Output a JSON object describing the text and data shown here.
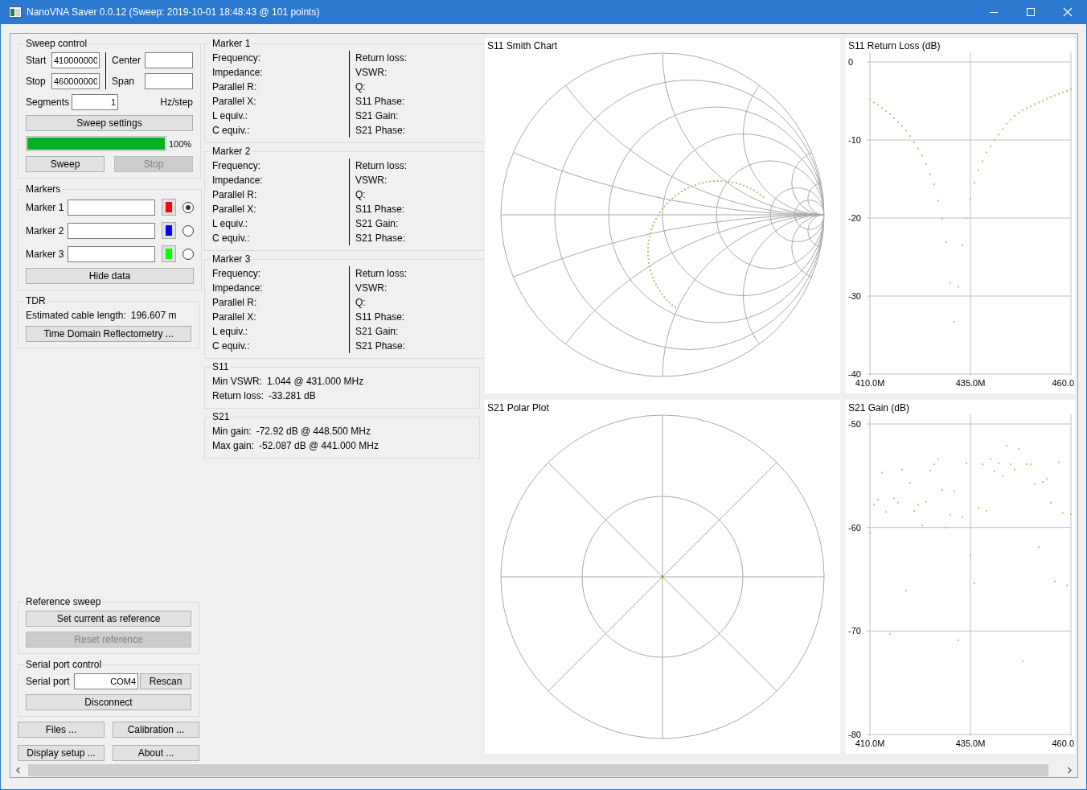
{
  "window": {
    "title": "NanoVNA Saver 0.0.12 (Sweep: 2019-10-01 18:48:43 @ 101 points)"
  },
  "sweep_control": {
    "title": "Sweep control",
    "start": {
      "label": "Start",
      "value": "410000000"
    },
    "stop": {
      "label": "Stop",
      "value": "460000000"
    },
    "center": {
      "label": "Center"
    },
    "span": {
      "label": "Span"
    },
    "segments": {
      "label": "Segments",
      "value": "1"
    },
    "step_label": "Hz/step",
    "settings_button": "Sweep settings",
    "progress": {
      "level": 1,
      "reading": "100%"
    },
    "buttons": [
      {
        "label": "Sweep",
        "disabled": false
      },
      {
        "label": "Stop",
        "disabled": true
      }
    ]
  },
  "markers": {
    "title": "Markers",
    "items": [
      {
        "label": "Marker 1",
        "color": "#ff0000",
        "selected": true
      },
      {
        "label": "Marker 2",
        "color": "#0000ff",
        "selected": false
      },
      {
        "label": "Marker 3",
        "color": "#00ff00",
        "selected": false
      }
    ],
    "hide_button": "Hide data"
  },
  "tdr": {
    "title": "TDR",
    "cable_length": {
      "label": "Estimated cable length:",
      "value": "196.607 m"
    },
    "button": "Time Domain Reflectometry ..."
  },
  "reference_sweep": {
    "title": "Reference sweep",
    "buttons": [
      {
        "label": "Set current as reference",
        "disabled": false
      },
      {
        "label": "Reset reference",
        "disabled": true
      }
    ]
  },
  "serial_port": {
    "title": "Serial port control",
    "label": "Serial port",
    "value": "COM4",
    "rescan_button": "Rescan",
    "disconnect_button": "Disconnect"
  },
  "bottom_buttons": [
    "Files ...",
    "Calibration ...",
    "Display setup ...",
    "About ..."
  ],
  "marker_details": [
    {
      "title": "Marker 1",
      "left": [
        "Frequency:",
        "Impedance:",
        "Parallel R:",
        "Parallel X:",
        "L equiv.:",
        "C equiv.:"
      ],
      "right": [
        "Return loss:",
        "VSWR:",
        "Q:",
        "S11 Phase:",
        "S21 Gain:",
        "S21 Phase:"
      ]
    },
    {
      "title": "Marker 2",
      "left": [
        "Frequency:",
        "Impedance:",
        "Parallel R:",
        "Parallel X:",
        "L equiv.:",
        "C equiv.:"
      ],
      "right": [
        "Return loss:",
        "VSWR:",
        "Q:",
        "S11 Phase:",
        "S21 Gain:",
        "S21 Phase:"
      ]
    },
    {
      "title": "Marker 3",
      "left": [
        "Frequency:",
        "Impedance:",
        "Parallel R:",
        "Parallel X:",
        "L equiv.:",
        "C equiv.:"
      ],
      "right": [
        "Return loss:",
        "VSWR:",
        "Q:",
        "S11 Phase:",
        "S21 Gain:",
        "S21 Phase:"
      ]
    }
  ],
  "s11": {
    "title": "S11",
    "lines": [
      {
        "label": "Min VSWR:",
        "value": "1.044 @ 431.000 MHz"
      },
      {
        "label": "Return loss:",
        "value": "-33.281 dB"
      }
    ]
  },
  "s21": {
    "title": "S21",
    "lines": [
      {
        "label": "Min gain:",
        "value": "-72.92 dB @ 448.500 MHz"
      },
      {
        "label": "Max gain:",
        "value": "-52.087 dB @ 441.000 MHz"
      }
    ]
  },
  "charts": {
    "smith": {
      "title": "S11 Smith Chart"
    },
    "return_loss": {
      "chart_data": {
        "type": "scatter",
        "title": "S11 Return Loss (dB)",
        "grid": true,
        "xlim": [
          410,
          460
        ],
        "ylim": [
          -40,
          0
        ],
        "xticks": [
          {
            "value": 410,
            "label": "410.0M"
          },
          {
            "value": 435,
            "label": "435.0M"
          },
          {
            "value": 460,
            "label": "460.0"
          }
        ],
        "yticks": [
          0,
          -10,
          -20,
          -30,
          -40
        ],
        "x": [
          410,
          411,
          412,
          413,
          414,
          415,
          416,
          417,
          418,
          419,
          420,
          421,
          422,
          423,
          424,
          425,
          426,
          427,
          428,
          429,
          430,
          431,
          432,
          433,
          434,
          435,
          436,
          437,
          438,
          439,
          440,
          441,
          442,
          443,
          444,
          445,
          446,
          447,
          448,
          449,
          450,
          451,
          452,
          453,
          454,
          455,
          456,
          457,
          458,
          459,
          460
        ],
        "series": [
          {
            "color": "#cbbd7c",
            "values": [
              -4.8,
              -5.2,
              -5.5,
              -5.9,
              -6.3,
              -6.7,
              -7.2,
              -7.7,
              -8.2,
              -8.8,
              -9.5,
              -10.3,
              -11.1,
              -12.0,
              -13.1,
              -14.4,
              -15.7,
              -17.8,
              -20.1,
              -23.1,
              -28.3,
              -33.3,
              -28.8,
              -23.5,
              -20.0,
              -17.6,
              -15.5,
              -13.9,
              -12.7,
              -11.6,
              -10.8,
              -10.0,
              -9.3,
              -8.6,
              -7.9,
              -7.4,
              -6.9,
              -6.5,
              -6.2,
              -5.9,
              -5.7,
              -5.4,
              -5.2,
              -5.0,
              -4.7,
              -4.5,
              -4.3,
              -4.1,
              -3.9,
              -3.7,
              -3.5
            ]
          }
        ]
      }
    },
    "polar": {
      "title": "S21 Polar Plot"
    },
    "gain": {
      "chart_data": {
        "type": "scatter",
        "title": "S21 Gain (dB)",
        "grid": true,
        "xlim": [
          410,
          460
        ],
        "ylim": [
          -80,
          -50
        ],
        "xticks": [
          {
            "value": 410,
            "label": "410.0M"
          },
          {
            "value": 435,
            "label": "435.0M"
          },
          {
            "value": 460,
            "label": "460.0"
          }
        ],
        "yticks": [
          -50,
          -60,
          -70,
          -80
        ],
        "x": [
          410,
          411,
          412,
          413,
          414,
          415,
          416,
          417,
          418,
          419,
          420,
          421,
          422,
          423,
          424,
          425,
          426,
          427,
          428,
          429,
          430,
          431,
          432,
          433,
          434,
          435,
          436,
          437,
          438,
          439,
          440,
          441,
          442,
          443,
          444,
          445,
          446,
          447,
          448,
          449,
          450,
          451,
          452,
          453,
          454,
          455,
          456,
          457,
          458,
          459,
          460
        ],
        "series": [
          {
            "color": "#cbbd7c",
            "values": [
              -60.5,
              -57.8,
              -57.3,
              -54.7,
              -58.5,
              -70.3,
              -57.2,
              -57.6,
              -54.4,
              -66.1,
              -55.7,
              -58.4,
              -57.8,
              -59.8,
              -57.5,
              -54.5,
              -53.9,
              -53.4,
              -56.4,
              -60.0,
              -58.8,
              -56.5,
              -70.9,
              -59.0,
              -53.8,
              -62.7,
              -65.4,
              -58.1,
              -53.9,
              -58.4,
              -53.4,
              -54.6,
              -53.8,
              -55.0,
              -52.1,
              -53.9,
              -54.4,
              -52.4,
              -72.9,
              -53.9,
              -53.9,
              -55.8,
              -61.9,
              -55.6,
              -55.3,
              -57.6,
              -65.2,
              -53.7,
              -58.6,
              -65.6,
              -58.7
            ]
          }
        ]
      }
    }
  }
}
